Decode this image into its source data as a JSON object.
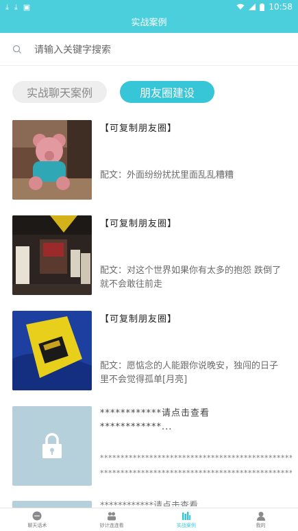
{
  "status_bar": {
    "time": "10:58"
  },
  "header": {
    "title": "实战案例"
  },
  "search": {
    "placeholder": "请输入关键字搜索"
  },
  "tabs": [
    {
      "label": "实战聊天案例",
      "active": false
    },
    {
      "label": "朋友圈建设",
      "active": true
    }
  ],
  "items": [
    {
      "title": "【可复制朋友圈】",
      "caption": "配文：外面纷纷扰扰里面乱乱糟糟",
      "image": "pink-teddy-bear-photo"
    },
    {
      "title": "【可复制朋友圈】",
      "caption": "配文：对这个世界如果你有太多的抱怨 跌倒了就不会敢往前走",
      "image": "street-shop-photo"
    },
    {
      "title": "【可复制朋友圈】",
      "caption": "配文：愿惦念的人能跟你说晚安，独闯的日子里不会觉得孤单[月亮]",
      "image": "yellow-book-photo"
    }
  ],
  "locked_item": {
    "title_line1": "************请点击查看",
    "title_line2": "************...",
    "stars_line1": "**************************************************",
    "stars_line2": "**************************************************"
  },
  "peek_item": {
    "text": "************请点击查看"
  },
  "bottom_nav": [
    {
      "label": "聊天话术",
      "icon": "chat-icon",
      "active": false
    },
    {
      "label": "妙计连连看",
      "icon": "people-icon",
      "active": false
    },
    {
      "label": "实战案例",
      "icon": "books-icon",
      "active": true
    },
    {
      "label": "我的",
      "icon": "user-icon",
      "active": false
    }
  ],
  "colors": {
    "primary": "#4ccfdc",
    "tab_active": "#36c6d8",
    "locked_thumb": "#b6d0db"
  }
}
